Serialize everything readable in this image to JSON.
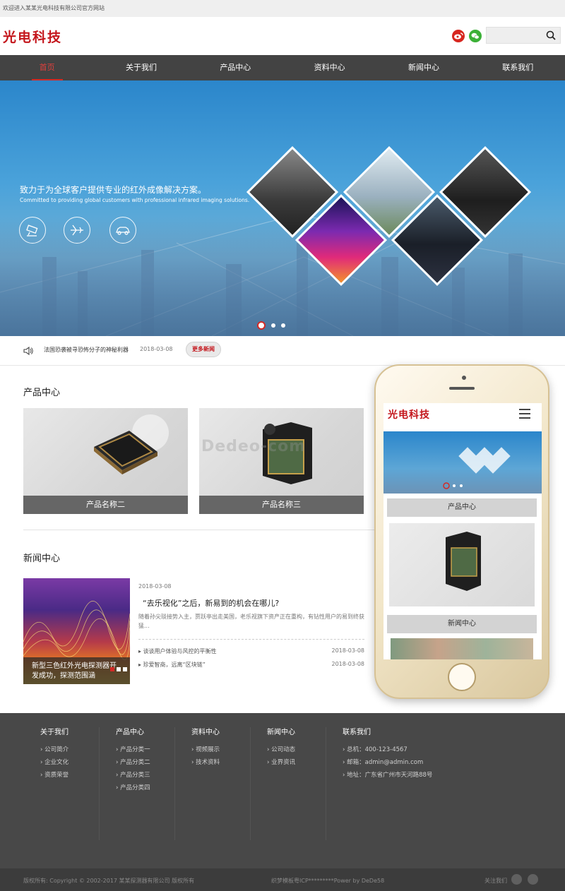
{
  "topbar": {
    "welcome": "欢迎进入某某光电科技有限公司官方网站"
  },
  "header": {
    "logo": "光电科技",
    "weibo_icon": "weibo-icon",
    "wechat_icon": "wechat-icon",
    "search_placeholder": ""
  },
  "nav": {
    "items": [
      {
        "label": "首页",
        "active": true
      },
      {
        "label": "关于我们"
      },
      {
        "label": "产品中心"
      },
      {
        "label": "资料中心"
      },
      {
        "label": "新闻中心"
      },
      {
        "label": "联系我们"
      }
    ]
  },
  "banner": {
    "title": "致力于为全球客户提供专业的红外成像解决方案。",
    "subtitle": "Committed to providing global customers with professional infrared imaging solutions.",
    "icons": [
      "camera-icon",
      "plane-icon",
      "car-icon"
    ],
    "slides": 3,
    "active_slide": 1
  },
  "news_ticker": {
    "text": "法国恐袭被寻恐怖分子的神秘利器",
    "date": "2018-03-08",
    "more": "更多新闻"
  },
  "products": {
    "title": "产品中心",
    "items": [
      {
        "name": "产品名称二"
      },
      {
        "name": "产品名称三"
      }
    ]
  },
  "news": {
    "title": "新闻中心",
    "featured_caption": "新型三色红外光电探测器开发成功，探测范围涵",
    "lead": {
      "date": "2018-03-08",
      "title": "“去乐视化”之后，新易到的机会在哪儿?",
      "desc": "随着孙尖琰接势入主，贾跃亭出走美国，老乐视旗下资产正在重构，有钻性用户的易到终获猛..."
    },
    "list": [
      {
        "title": "谈谈用户体验与风控的平衡性",
        "date": "2018-03-08"
      },
      {
        "title": "珍爱智商，远离“区块链”",
        "date": "2018-03-08"
      }
    ]
  },
  "watermark": "Dedeo-com",
  "phone": {
    "logo": "光电科技",
    "product_head": "产品中心",
    "news_head": "新闻中心"
  },
  "footer": {
    "cols": [
      {
        "title": "关于我们",
        "items": [
          "公司简介",
          "企业文化",
          "资质荣誉"
        ]
      },
      {
        "title": "产品中心",
        "items": [
          "产品分类一",
          "产品分类二",
          "产品分类三",
          "产品分类四"
        ]
      },
      {
        "title": "资料中心",
        "items": [
          "视频展示",
          "技术资料"
        ]
      },
      {
        "title": "新闻中心",
        "items": [
          "公司动态",
          "业界资讯"
        ]
      },
      {
        "title": "联系我们",
        "items": [
          "总机：400-123-4567",
          "邮箱：admin@admin.com",
          "地址：广东省广州市天河路88号"
        ]
      }
    ]
  },
  "bottom": {
    "copyright": "版权所有: Copyright © 2002-2017 某某探测器有限公司 版权所有",
    "icp": "织梦模板粤ICP*********Power by DeDe58",
    "follow": "关注我们"
  },
  "colors": {
    "brand": "#c4161c",
    "nav_bg": "#434343",
    "footer_bg": "#484848"
  }
}
